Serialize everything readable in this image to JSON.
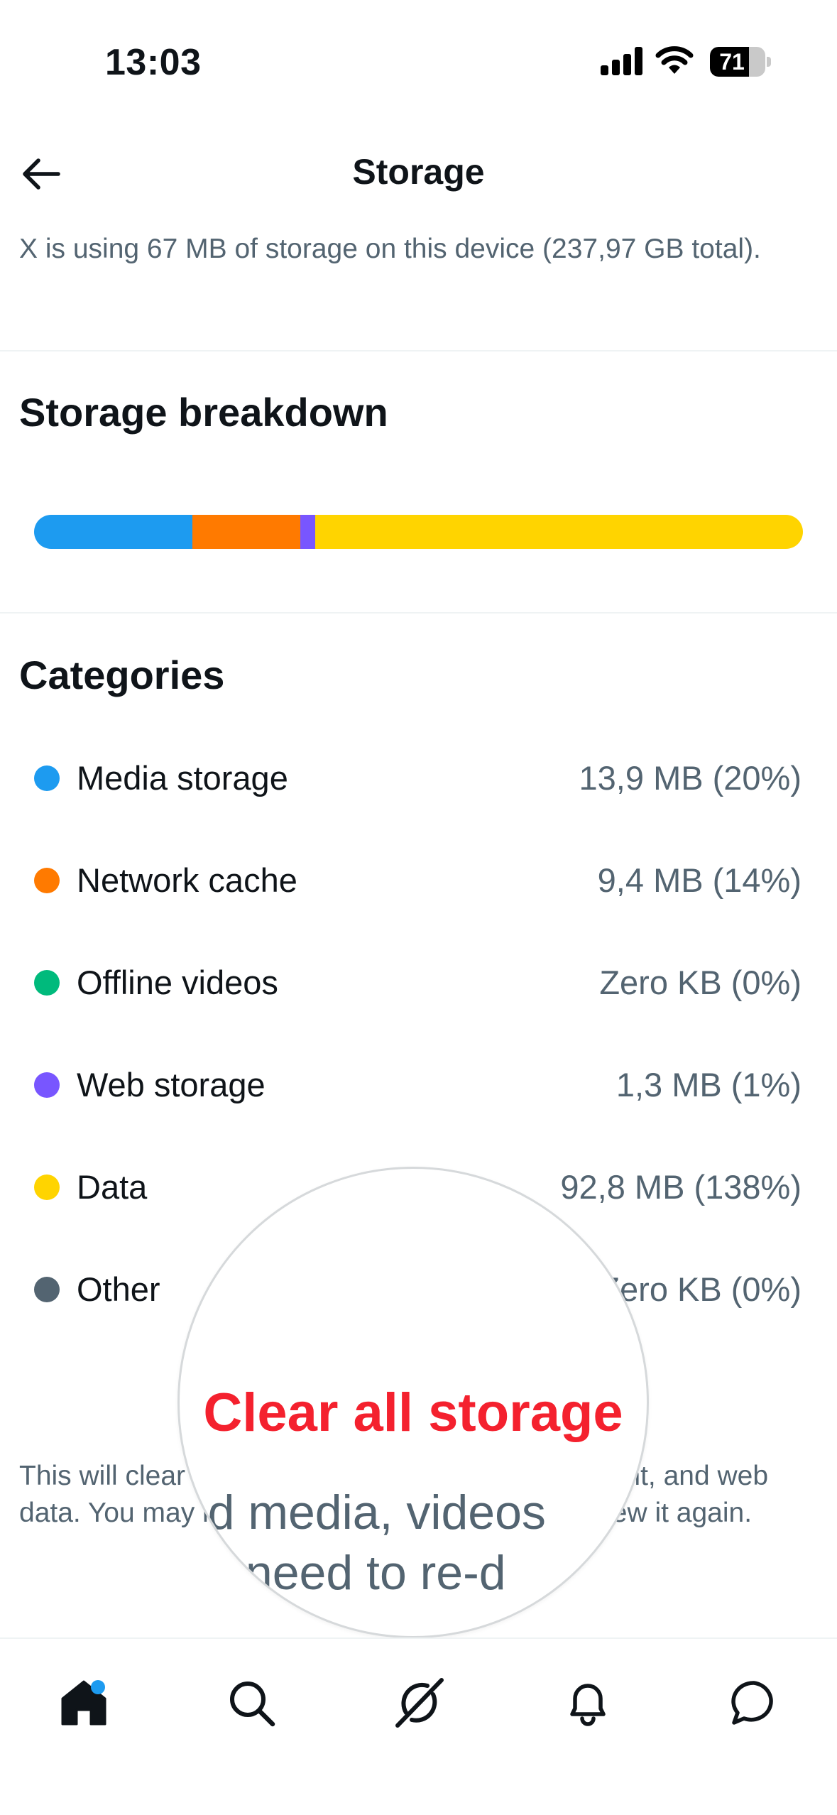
{
  "status_bar": {
    "time": "13:03",
    "battery_level": "71",
    "battery_fraction": 0.71
  },
  "header": {
    "title": "Storage"
  },
  "usage": {
    "text": "X is using 67 MB of storage on this device (237,97 GB total)."
  },
  "breakdown": {
    "heading": "Storage breakdown",
    "segments": [
      {
        "name": "Media storage",
        "fraction": 0.206,
        "color": "#1d9bf0"
      },
      {
        "name": "Network cache",
        "fraction": 0.14,
        "color": "#ff7a00"
      },
      {
        "name": "Web storage",
        "fraction": 0.02,
        "color": "#7856ff"
      },
      {
        "name": "Data",
        "fraction": 0.634,
        "color": "#ffd400"
      }
    ]
  },
  "categories": {
    "heading": "Categories",
    "items": [
      {
        "label": "Media storage",
        "value": "13,9 MB (20%)",
        "color": "#1d9bf0"
      },
      {
        "label": "Network cache",
        "value": "9,4 MB (14%)",
        "color": "#ff7a00"
      },
      {
        "label": "Offline videos",
        "value": "Zero KB (0%)",
        "color": "#00ba7c"
      },
      {
        "label": "Web storage",
        "value": "1,3 MB (1%)",
        "color": "#7856ff"
      },
      {
        "label": "Data",
        "value": "92,8 MB (138%)",
        "color": "#ffd400"
      },
      {
        "label": "Other",
        "value": "Zero KB (0%)",
        "color": "#536471"
      }
    ]
  },
  "clear": {
    "button_label": "Clear all storage",
    "description": "This will clear cached media, videos, offline content, and web data. You may need to re-download content to view it again.",
    "magnified_line1": "ched media, videos",
    "magnified_line2": "y need to re-d"
  },
  "tab_bar": {
    "tabs": [
      {
        "name": "home",
        "icon": "home-icon",
        "badge": true
      },
      {
        "name": "search",
        "icon": "search-icon",
        "badge": false
      },
      {
        "name": "grok",
        "icon": "grok-icon",
        "badge": false
      },
      {
        "name": "notifications",
        "icon": "bell-icon",
        "badge": false
      },
      {
        "name": "messages",
        "icon": "message-icon",
        "badge": false
      }
    ],
    "accent_color": "#1d9bf0"
  }
}
